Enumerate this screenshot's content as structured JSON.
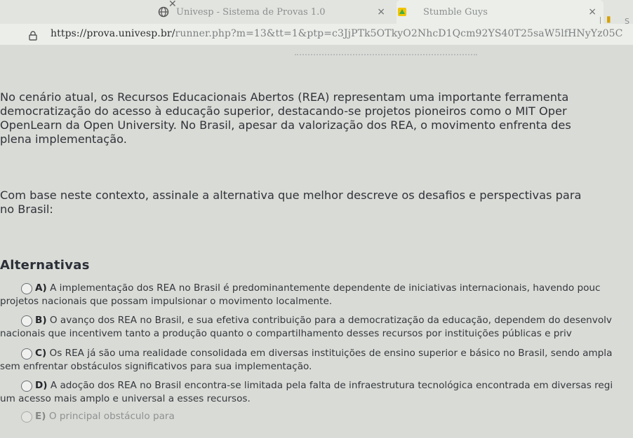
{
  "browser": {
    "tabs": [
      {
        "title": "Univesp - Sistema de Provas 1.0",
        "close": "×",
        "active": false
      },
      {
        "title": "Stumble Guys",
        "close": "×",
        "active": true
      }
    ],
    "extra_tab_letter": "S",
    "url_host": "https://prova.univesp.br/",
    "url_rest": "runner.php?m=13&tt=1&ptp=c3JjPTk5OTkyO2NhcD1Qcm92YS40T25saW5lfHNyYz05C"
  },
  "question": {
    "paragraph1": [
      "No cenário atual, os Recursos Educacionais Abertos (REA) representam uma importante ferramenta",
      "democratização do acesso à educação superior, destacando-se projetos pioneiros como o MIT Oper",
      "OpenLearn da Open University. No Brasil, apesar da valorização dos REA, o movimento enfrenta des",
      "plena implementação."
    ],
    "paragraph2": [
      "Com base neste contexto, assinale a alternativa que melhor descreve os desafios e perspectivas para",
      "no Brasil:"
    ],
    "alternatives_heading": "Alternativas",
    "alternatives": [
      {
        "letter": "A)",
        "line1": "A implementação dos REA no Brasil é predominantemente dependente de iniciativas internacionais, havendo pouc",
        "line2": "projetos nacionais que possam impulsionar o movimento localmente."
      },
      {
        "letter": "B)",
        "line1": "O avanço dos REA no Brasil, e sua efetiva contribuição para a democratização da educação, dependem do desenvolv",
        "line2": "nacionais que incentivem tanto a produção quanto o compartilhamento desses recursos por instituições públicas e priv"
      },
      {
        "letter": "C)",
        "line1": "Os REA já são uma realidade consolidada em diversas instituições de ensino superior e básico no Brasil, sendo ampla",
        "line2": "sem enfrentar obstáculos significativos para sua implementação."
      },
      {
        "letter": "D)",
        "line1": "A adoção dos REA no Brasil encontra-se limitada pela falta de infraestrutura tecnológica encontrada em diversas regi",
        "line2": "um acesso mais amplo e universal a esses recursos."
      },
      {
        "letter": "E)",
        "line1": "O principal obstáculo para",
        "line2": ""
      }
    ]
  }
}
